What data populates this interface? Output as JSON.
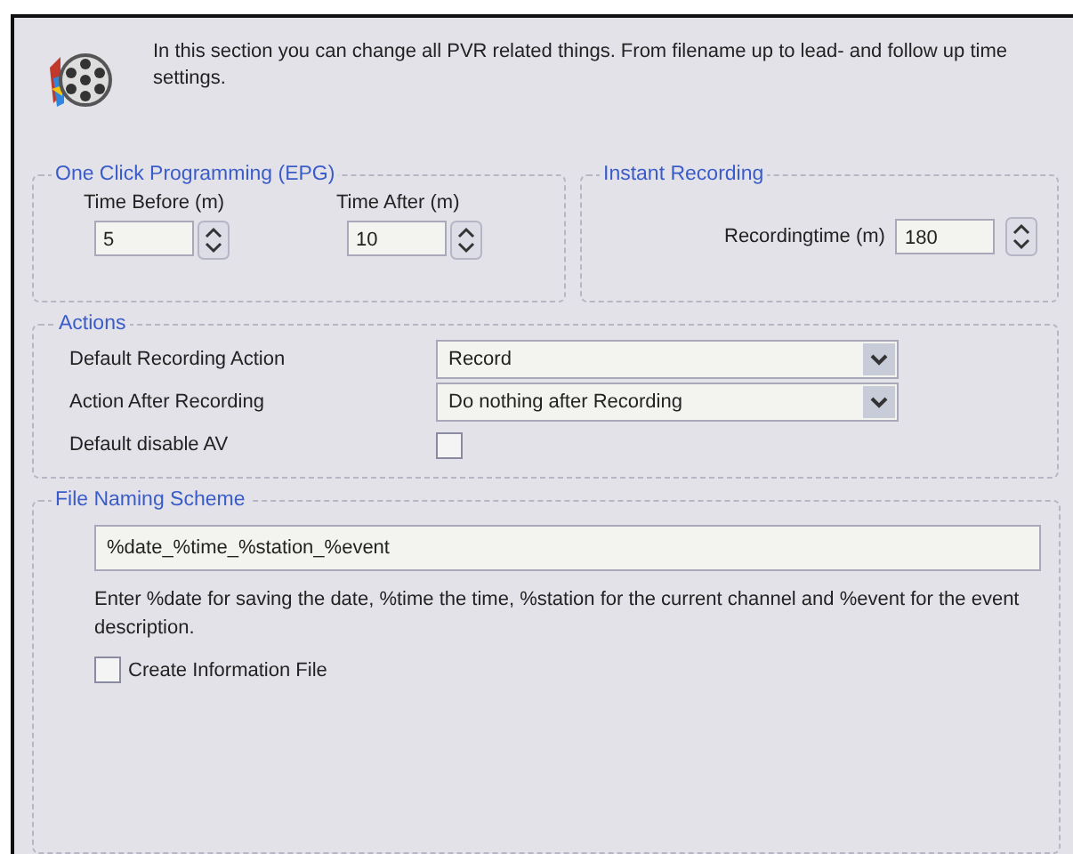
{
  "header": {
    "description": "In this section you can change all PVR related things. From filename up to lead- and follow up time settings."
  },
  "epg": {
    "title": "One Click Programming (EPG)",
    "fields": [
      {
        "label": "Time Before (m)",
        "value": "5"
      },
      {
        "label": "Time After (m)",
        "value": "10"
      }
    ]
  },
  "instant_recording": {
    "title": "Instant Recording",
    "label": "Recordingtime (m)",
    "value": "180"
  },
  "actions": {
    "title": "Actions",
    "rows": [
      {
        "kind": "dropdown",
        "label": "Default Recording Action",
        "value": "Record"
      },
      {
        "kind": "dropdown",
        "label": "Action After Recording",
        "value": "Do nothing after Recording"
      },
      {
        "kind": "checkbox",
        "label": "Default disable AV",
        "checked": false
      }
    ]
  },
  "file_naming": {
    "title": "File Naming Scheme",
    "value": "%date_%time_%station_%event",
    "help": "Enter %date for saving the date, %time the time, %station for the current channel and %event for the event description.",
    "checkbox": {
      "label": "Create Information File",
      "checked": false
    }
  }
}
